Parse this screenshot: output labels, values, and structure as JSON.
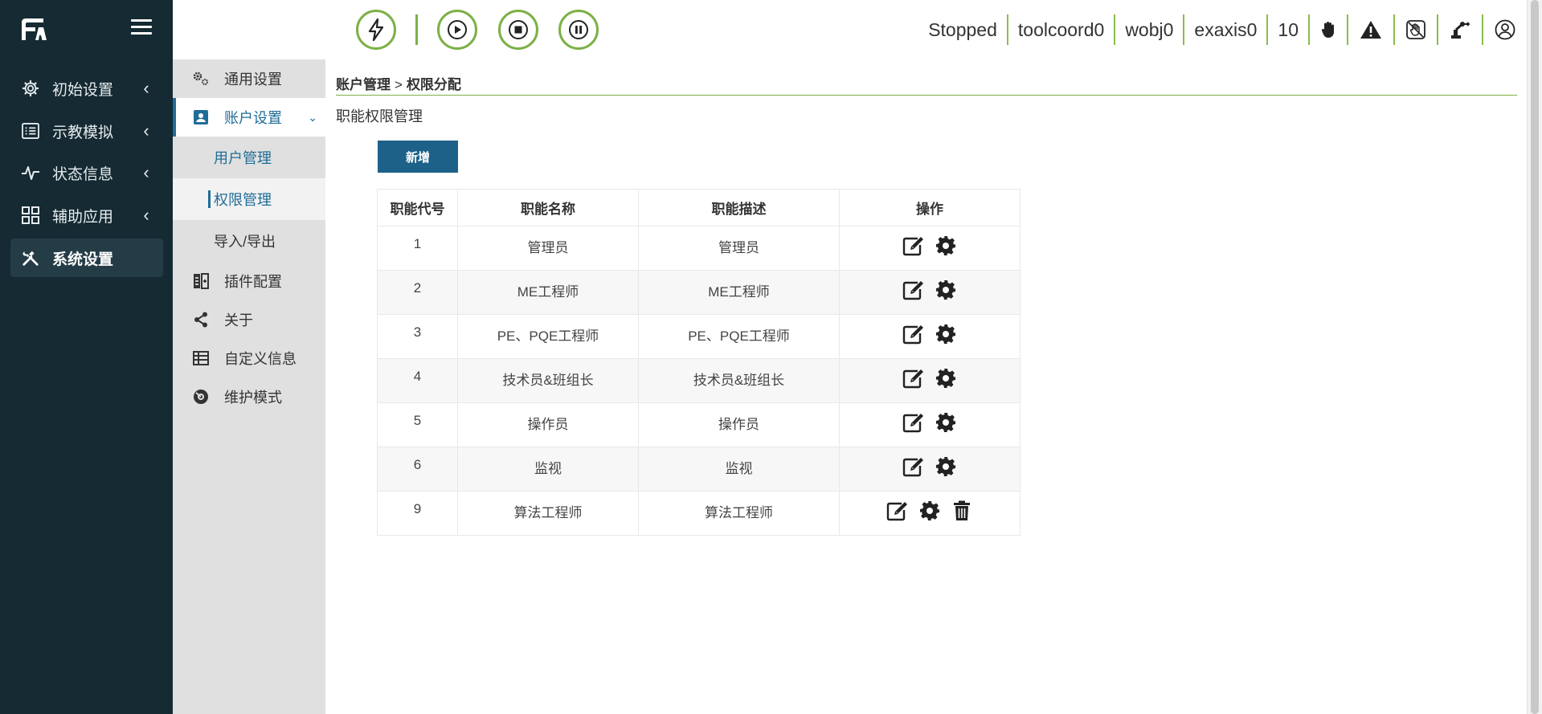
{
  "sidebar": {
    "items": [
      {
        "label": "初始设置",
        "icon": "gear-icon"
      },
      {
        "label": "示教模拟",
        "icon": "list-icon"
      },
      {
        "label": "状态信息",
        "icon": "pulse-icon"
      },
      {
        "label": "辅助应用",
        "icon": "grid-icon"
      },
      {
        "label": "系统设置",
        "icon": "tools-icon",
        "active": true
      }
    ]
  },
  "topbar": {
    "status": "Stopped",
    "tool_coord": "toolcoord0",
    "work_obj": "wobj0",
    "ext_axis": "exaxis0",
    "speed": "10"
  },
  "subnav": {
    "general": "通用设置",
    "account": "账户设置",
    "user_mgmt": "用户管理",
    "perm_mgmt": "权限管理",
    "import_export": "导入/导出",
    "plugin": "插件配置",
    "about": "关于",
    "custom_info": "自定义信息",
    "maintenance": "维护模式"
  },
  "main": {
    "breadcrumb_parent": "账户管理",
    "breadcrumb_sep": ">",
    "breadcrumb_current": "权限分配",
    "section_title": "职能权限管理",
    "add_label": "新增",
    "table": {
      "headers": [
        "职能代号",
        "职能名称",
        "职能描述",
        "操作"
      ],
      "rows": [
        {
          "code": "1",
          "name": "管理员",
          "desc": "管理员"
        },
        {
          "code": "2",
          "name": "ME工程师",
          "desc": "ME工程师"
        },
        {
          "code": "3",
          "name": "PE、PQE工程师",
          "desc": "PE、PQE工程师"
        },
        {
          "code": "4",
          "name": "技术员&班组长",
          "desc": "技术员&班组长"
        },
        {
          "code": "5",
          "name": "操作员",
          "desc": "操作员"
        },
        {
          "code": "6",
          "name": "监视",
          "desc": "监视"
        },
        {
          "code": "9",
          "name": "算法工程师",
          "desc": "算法工程师",
          "deletable": true
        }
      ]
    }
  },
  "colors": {
    "sidebar_bg": "#152a33",
    "accent_green": "#7db046",
    "primary_blue": "#1d6189"
  }
}
